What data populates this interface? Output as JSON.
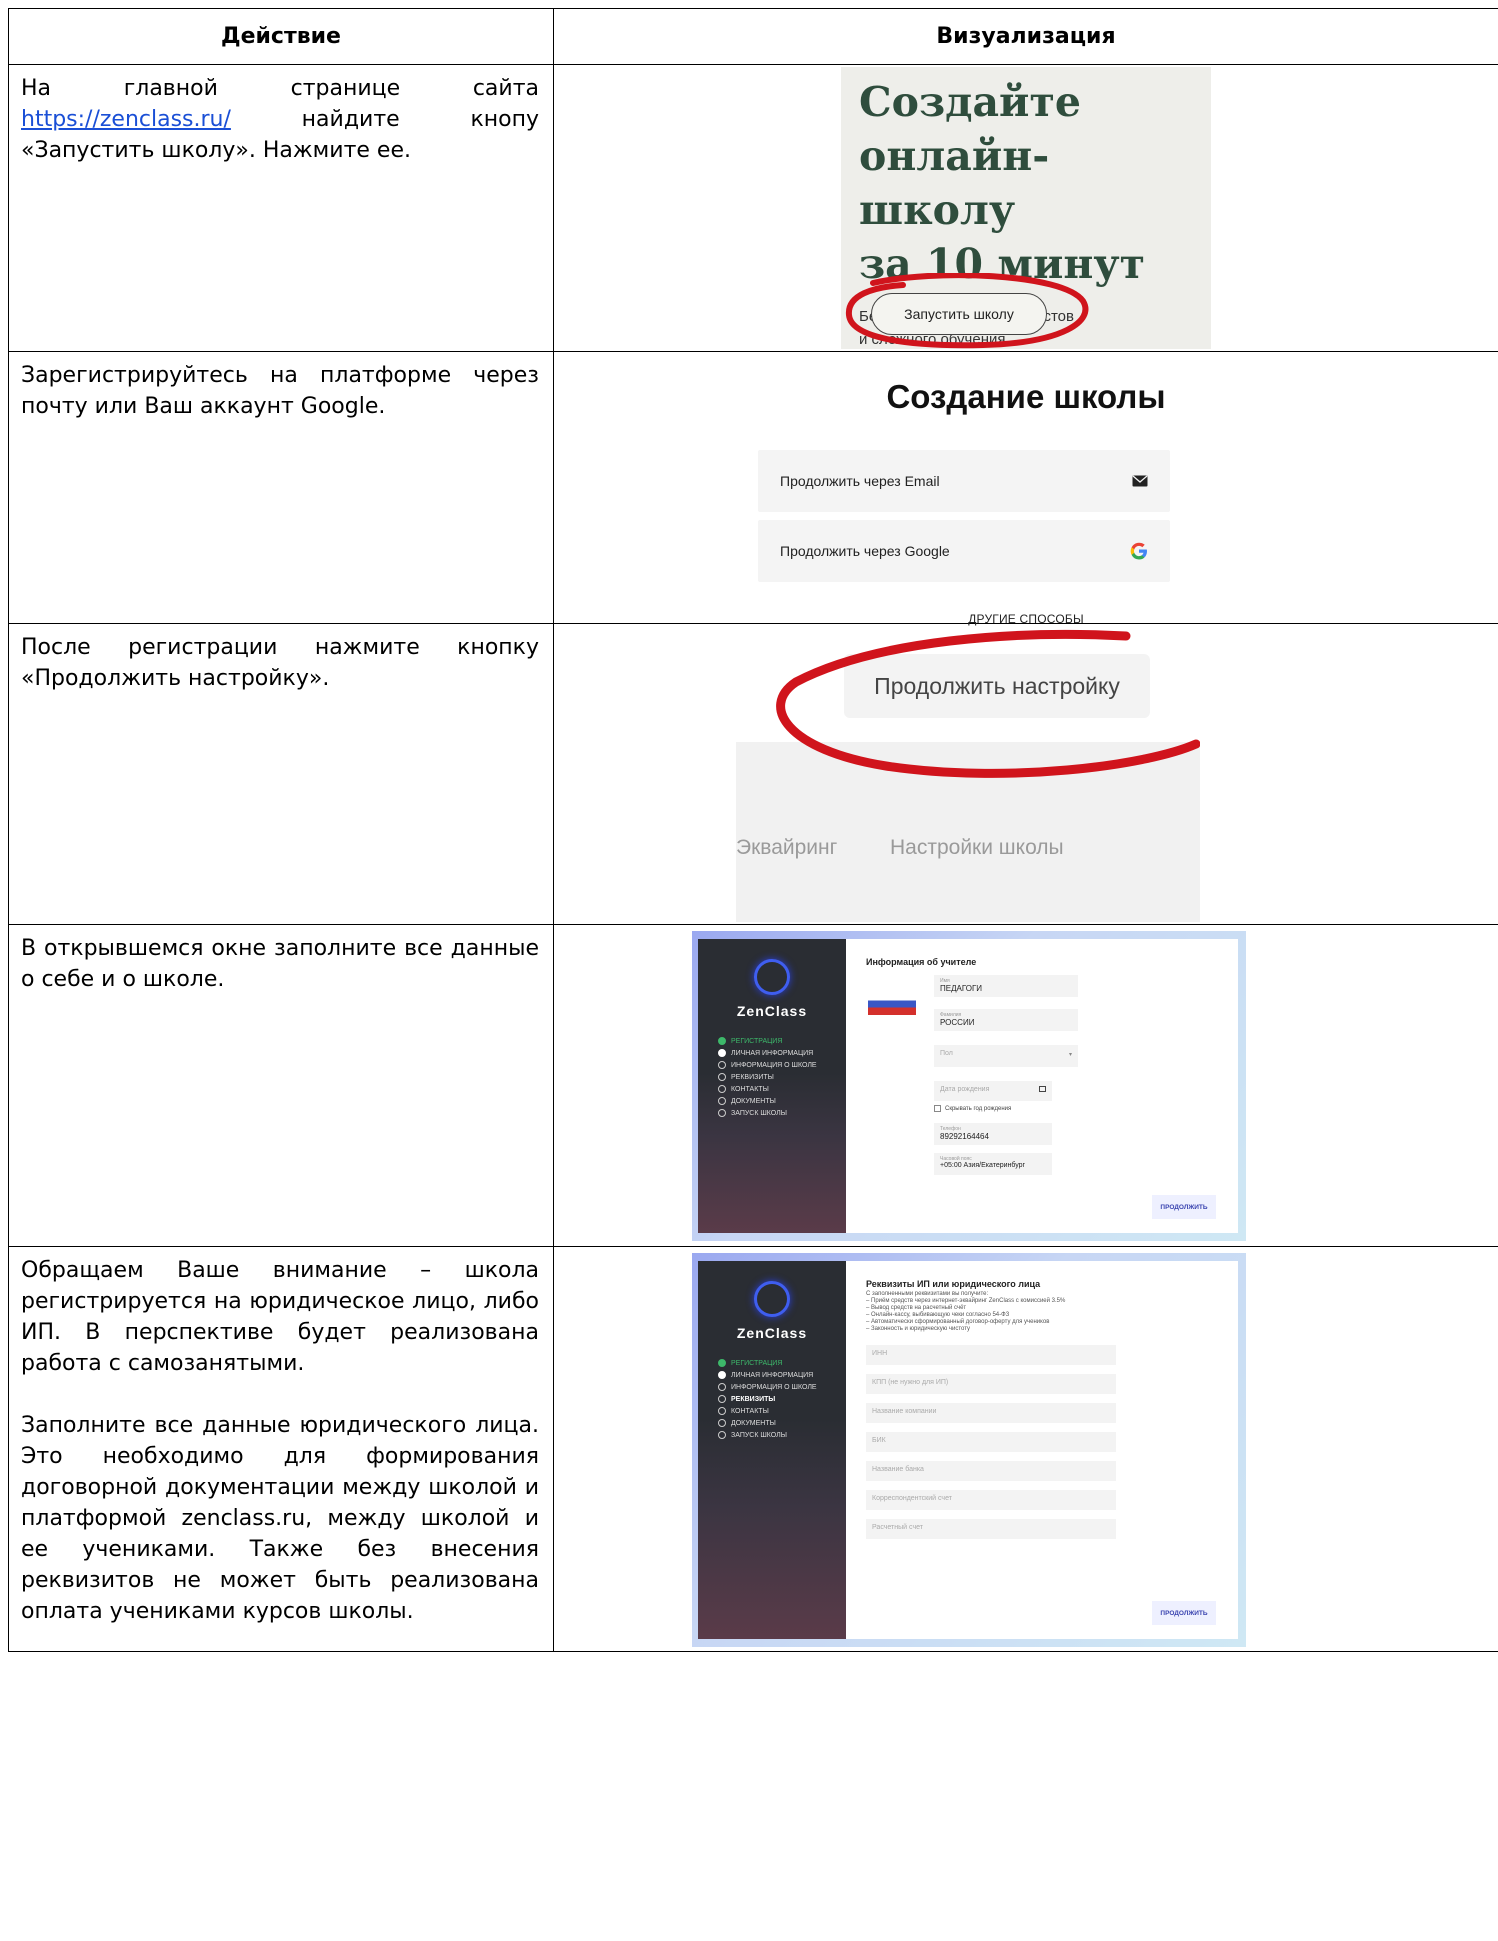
{
  "table": {
    "col_action": "Действие",
    "col_visual": "Визуализация"
  },
  "rows": [
    {
      "action_before": "На главной странице сайта ",
      "link": "https://zenclass.ru/",
      "action_after": " найдите кнопу «Запустить школу». Нажмите ее.",
      "visual": {
        "title_lines": [
          "Создайте",
          "онлайн-школу",
          "за 10 минут"
        ],
        "subtitle_lines": [
          "Без технических специалистов",
          "и сложного обучения."
        ],
        "button": "Запустить школу"
      }
    },
    {
      "action": "Зарегистрируйтесь на платформе через почту или Ваш аккаунт Google.",
      "visual": {
        "title": "Создание школы",
        "email_button": "Продолжить через Email",
        "email_icon": "envelope-icon",
        "google_button": "Продолжить через Google",
        "google_icon": "google-icon",
        "other": "ДРУГИЕ СПОСОБЫ"
      }
    },
    {
      "action": "После регистрации нажмите кнопку «Продолжить настройку».",
      "visual": {
        "button": "Продолжить настройку",
        "tab1": "Эквайринг",
        "tab2": "Настройки школы"
      }
    },
    {
      "action": "В открывшемся окне заполните все данные о себе и о школе.",
      "visual": {
        "logo": "ZenClass",
        "steps": [
          "РЕГИСТРАЦИЯ",
          "ЛИЧНАЯ ИНФОРМАЦИЯ",
          "ИНФОРМАЦИЯ О ШКОЛЕ",
          "РЕКВИЗИТЫ",
          "КОНТАКТЫ",
          "ДОКУМЕНТЫ",
          "ЗАПУСК ШКОЛЫ"
        ],
        "form_title": "Информация об учителе",
        "name_label": "Имя",
        "name_value": "ПЕДАГОГИ",
        "surname_label": "Фамилия",
        "surname_value": "РОССИИ",
        "gender_placeholder": "Пол",
        "birth_placeholder": "Дата рождения",
        "hide_year": "Скрывать год рождения",
        "phone_label": "Телефон",
        "phone_value": "89292164464",
        "tz_label": "Часовой пояс",
        "tz_value": "+05:00 Азия/Екатеринбург",
        "submit": "ПРОДОЛЖИТЬ"
      }
    },
    {
      "action_p1": "Обращаем Ваше внимание – школа регистрируется на юридическое лицо, либо ИП. В перспективе будет реализована работа с самозанятыми.",
      "action_p2": "Заполните все данные юридического лица. Это необходимо для формирования договорной документации между школой и платформой zenclass.ru, между школой и ее учениками. Также без внесения реквизитов не может быть реализована оплата учениками курсов школы.",
      "visual": {
        "logo": "ZenClass",
        "steps": [
          "РЕГИСТРАЦИЯ",
          "ЛИЧНАЯ ИНФОРМАЦИЯ",
          "ИНФОРМАЦИЯ О ШКОЛЕ",
          "РЕКВИЗИТЫ",
          "КОНТАКТЫ",
          "ДОКУМЕНТЫ",
          "ЗАПУСК ШКОЛЫ"
        ],
        "form_title": "Реквизиты ИП или юридического лица",
        "intro": [
          "С заполненными реквизитами вы получите:",
          "– Приём средств через интернет-эквайринг ZenClass с комиссией 3.5%",
          "– Вывод средств на расчетный счёт",
          "– Онлайн-кассу, выбивающую чеки согласно 54-ФЗ",
          "– Автоматически сформированный договор-оферту для учеников",
          "– Законность и юридическую чистоту"
        ],
        "fields": [
          "ИНН",
          "КПП (не нужно для ИП)",
          "Название компании",
          "БИК",
          "Название банка",
          "Корреспондентский счет",
          "Расчетный счет"
        ],
        "submit": "ПРОДОЛЖИТЬ"
      }
    }
  ]
}
